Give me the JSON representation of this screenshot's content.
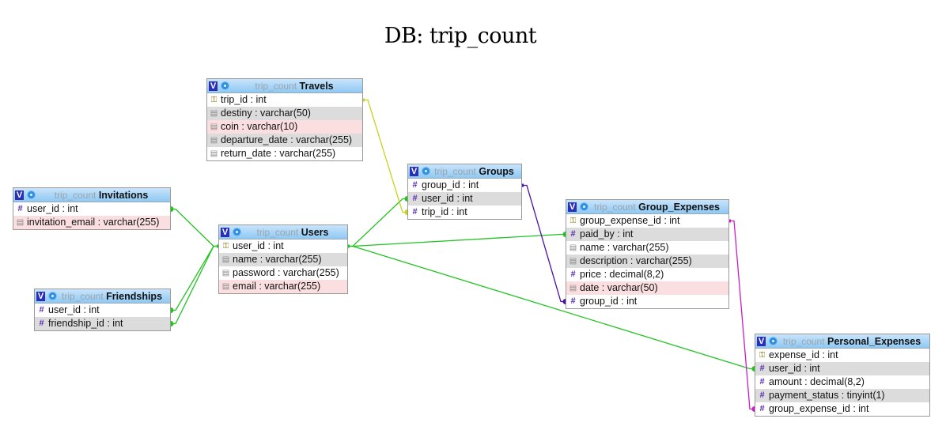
{
  "title": "DB: trip_count",
  "db_prefix": "trip_count",
  "tables": {
    "travels": {
      "name": "Travels",
      "columns": [
        {
          "icon": "key-icon",
          "label": "trip_id : int",
          "bg": "normal"
        },
        {
          "icon": "text-icon",
          "label": "destiny : varchar(50)",
          "bg": "alt"
        },
        {
          "icon": "text-icon",
          "label": "coin : varchar(10)",
          "bg": "pink"
        },
        {
          "icon": "text-icon",
          "label": "departure_date : varchar(255)",
          "bg": "alt"
        },
        {
          "icon": "text-icon",
          "label": "return_date : varchar(255)",
          "bg": "normal"
        }
      ]
    },
    "invitations": {
      "name": "Invitations",
      "columns": [
        {
          "icon": "hash-icon",
          "label": "user_id : int",
          "bg": "normal"
        },
        {
          "icon": "text-icon",
          "label": "invitation_email : varchar(255)",
          "bg": "pink"
        }
      ]
    },
    "friendships": {
      "name": "Friendships",
      "columns": [
        {
          "icon": "hash-icon",
          "label": "user_id : int",
          "bg": "normal"
        },
        {
          "icon": "hash-icon",
          "label": "friendship_id : int",
          "bg": "alt"
        }
      ]
    },
    "users": {
      "name": "Users",
      "columns": [
        {
          "icon": "key-icon",
          "label": "user_id : int",
          "bg": "normal"
        },
        {
          "icon": "text-icon",
          "label": "name : varchar(255)",
          "bg": "alt"
        },
        {
          "icon": "text-icon",
          "label": "password : varchar(255)",
          "bg": "normal"
        },
        {
          "icon": "text-icon",
          "label": "email : varchar(255)",
          "bg": "pink"
        }
      ]
    },
    "groups": {
      "name": "Groups",
      "columns": [
        {
          "icon": "hash-icon",
          "label": "group_id : int",
          "bg": "normal"
        },
        {
          "icon": "hash-icon",
          "label": "user_id : int",
          "bg": "alt"
        },
        {
          "icon": "hash-icon",
          "label": "trip_id : int",
          "bg": "normal"
        }
      ]
    },
    "group_expenses": {
      "name": "Group_Expenses",
      "columns": [
        {
          "icon": "key-icon",
          "label": "group_expense_id : int",
          "bg": "normal"
        },
        {
          "icon": "hash-icon",
          "label": "paid_by : int",
          "bg": "alt"
        },
        {
          "icon": "text-icon",
          "label": "name : varchar(255)",
          "bg": "normal"
        },
        {
          "icon": "text-icon",
          "label": "description : varchar(255)",
          "bg": "alt"
        },
        {
          "icon": "hash-icon",
          "label": "price : decimal(8,2)",
          "bg": "normal"
        },
        {
          "icon": "text-icon",
          "label": "date : varchar(50)",
          "bg": "pink"
        },
        {
          "icon": "hash-icon",
          "label": "group_id : int",
          "bg": "normal"
        }
      ]
    },
    "personal_expenses": {
      "name": "Personal_Expenses",
      "columns": [
        {
          "icon": "key-icon",
          "label": "expense_id : int",
          "bg": "normal"
        },
        {
          "icon": "hash-icon",
          "label": "user_id : int",
          "bg": "alt"
        },
        {
          "icon": "hash-icon",
          "label": "amount : decimal(8,2)",
          "bg": "normal"
        },
        {
          "icon": "hash-icon",
          "label": "payment_status : tinyint(1)",
          "bg": "alt"
        },
        {
          "icon": "hash-icon",
          "label": "group_expense_id : int",
          "bg": "normal"
        }
      ]
    }
  },
  "relations": [
    {
      "from": "invitations.user_id",
      "to": "users.user_id",
      "color": "#22c322"
    },
    {
      "from": "friendships.user_id",
      "to": "users.user_id",
      "color": "#22c322"
    },
    {
      "from": "friendships.friendship_id",
      "to": "users.user_id",
      "color": "#22c322"
    },
    {
      "from": "groups.user_id",
      "to": "users.user_id",
      "color": "#22c322"
    },
    {
      "from": "group_expenses.paid_by",
      "to": "users.user_id",
      "color": "#22c322"
    },
    {
      "from": "personal_expenses.user_id",
      "to": "users.user_id",
      "color": "#22c322"
    },
    {
      "from": "groups.trip_id",
      "to": "travels.trip_id",
      "color": "#c8d21e"
    },
    {
      "from": "group_expenses.group_id",
      "to": "groups.group_id",
      "color": "#4a0fa8"
    },
    {
      "from": "personal_expenses.group_expense_id",
      "to": "group_expenses.group_expense_id",
      "color": "#c81ec8"
    }
  ],
  "icons": {
    "key-icon": "⚿",
    "hash-icon": "#",
    "text-icon": "▤",
    "v-icon": "V",
    "gear-icon": "⚙"
  }
}
